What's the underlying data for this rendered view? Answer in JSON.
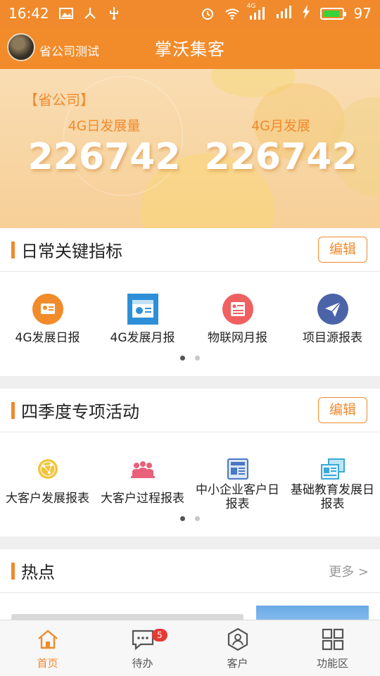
{
  "status_bar": {
    "time": "16:42",
    "network_label": "4G",
    "battery": "97",
    "battery_color": "#3ad13a"
  },
  "header": {
    "user_name": "省公司测试",
    "app_title": "掌沃集客"
  },
  "banner": {
    "tag": "【省公司】",
    "metrics": [
      {
        "label": "4G日发展量",
        "value": "226742"
      },
      {
        "label": "4G月发展",
        "value": "226742"
      }
    ]
  },
  "daily_section": {
    "title": "日常关键指标",
    "edit_label": "编辑",
    "items": [
      {
        "label": "4G发展日报",
        "icon": "report-card-icon",
        "color": "#f28b2a"
      },
      {
        "label": "4G发展月报",
        "icon": "calendar-icon",
        "color": "#2e8fd9"
      },
      {
        "label": "物联网月报",
        "icon": "list-document-icon",
        "color": "#f06060"
      },
      {
        "label": "项目源报表",
        "icon": "paper-plane-icon",
        "color": "#4b63a8"
      }
    ]
  },
  "quarter_section": {
    "title": "四季度专项活动",
    "edit_label": "编辑",
    "items": [
      {
        "label": "大客户发展报表",
        "icon": "network-globe-icon",
        "color": "#f3c43a"
      },
      {
        "label": "大客户过程报表",
        "icon": "group-people-icon",
        "color": "#e8607a"
      },
      {
        "label": "中小企业客户日报表",
        "icon": "newspaper-icon",
        "color": "#4a78c2"
      },
      {
        "label": "基础教育发展日报表",
        "icon": "news-stack-icon",
        "color": "#3aa9d9"
      }
    ]
  },
  "hot_section": {
    "title": "热点",
    "more_label": "更多 >"
  },
  "bottom_nav": [
    {
      "label": "首页",
      "icon": "home-icon",
      "active": true
    },
    {
      "label": "待办",
      "icon": "chat-todo-icon",
      "badge": "5"
    },
    {
      "label": "客户",
      "icon": "customer-icon"
    },
    {
      "label": "功能区",
      "icon": "grid-apps-icon"
    }
  ],
  "colors": {
    "accent": "#f08a2c",
    "badge": "#e53935"
  }
}
